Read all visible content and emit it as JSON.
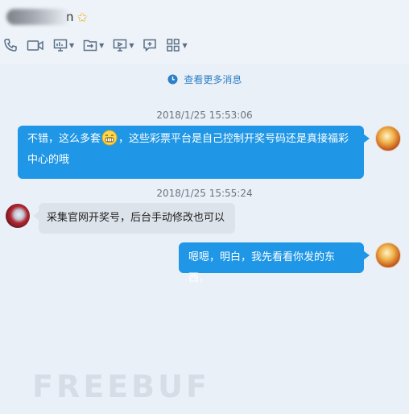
{
  "header": {
    "name_suffix": "n"
  },
  "toolbar": {
    "icons": [
      "phone-icon",
      "video-icon",
      "screen-share-icon",
      "file-transfer-icon",
      "remote-desktop-icon",
      "add-chat-icon",
      "apps-grid-icon"
    ]
  },
  "history": {
    "label": "查看更多消息"
  },
  "messages": [
    {
      "time": "2018/1/25 15:53:06",
      "text_a": "不错，这么多套",
      "text_b": "，这些彩票平台是自己控制开奖号码还是真接福彩",
      "text_c": "中心的哦",
      "side": "right"
    },
    {
      "time": "2018/1/25 15:55:24",
      "text": "采集官网开奖号，后台手动修改也可以",
      "side": "left"
    },
    {
      "text": "嗯嗯，明白，我先看看你发的东西，",
      "side": "right"
    }
  ],
  "watermark": "FREEBUF",
  "colors": {
    "outgoing": "#1f97e6",
    "incoming": "#dde3ea",
    "link": "#2d7fc6",
    "background": "#eaf0f8"
  }
}
